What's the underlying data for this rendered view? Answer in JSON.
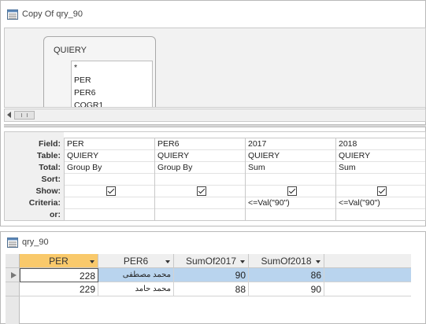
{
  "design_window": {
    "title": "Copy Of qry_90",
    "field_list": {
      "table_name": "QUIERY",
      "fields": [
        "*",
        "PER",
        "PER6",
        "COGR1"
      ]
    },
    "grid": {
      "row_labels": [
        "Field:",
        "Table:",
        "Total:",
        "Sort:",
        "Show:",
        "Criteria:",
        "or:"
      ],
      "columns": [
        {
          "field": "PER",
          "table": "QUIERY",
          "total": "Group By",
          "sort": "",
          "show": true,
          "criteria": "",
          "or": ""
        },
        {
          "field": "PER6",
          "table": "QUIERY",
          "total": "Group By",
          "sort": "",
          "show": true,
          "criteria": "",
          "or": ""
        },
        {
          "field": "2017",
          "table": "QUIERY",
          "total": "Sum",
          "sort": "",
          "show": true,
          "criteria": "<=Val(\"90\")",
          "or": ""
        },
        {
          "field": "2018",
          "table": "QUIERY",
          "total": "Sum",
          "sort": "",
          "show": true,
          "criteria": "<=Val(\"90\")",
          "or": ""
        }
      ]
    }
  },
  "datasheet_window": {
    "title": "qry_90",
    "columns": [
      "PER",
      "PER6",
      "SumOf2017",
      "SumOf2018"
    ],
    "rows": [
      [
        "228",
        "محمد مصطفى",
        "90",
        "86"
      ],
      [
        "229",
        "محمد حامد",
        "88",
        "90"
      ]
    ]
  },
  "colors": {
    "active_header": "#f9c96b",
    "selected_row": "#b9d4ee"
  }
}
